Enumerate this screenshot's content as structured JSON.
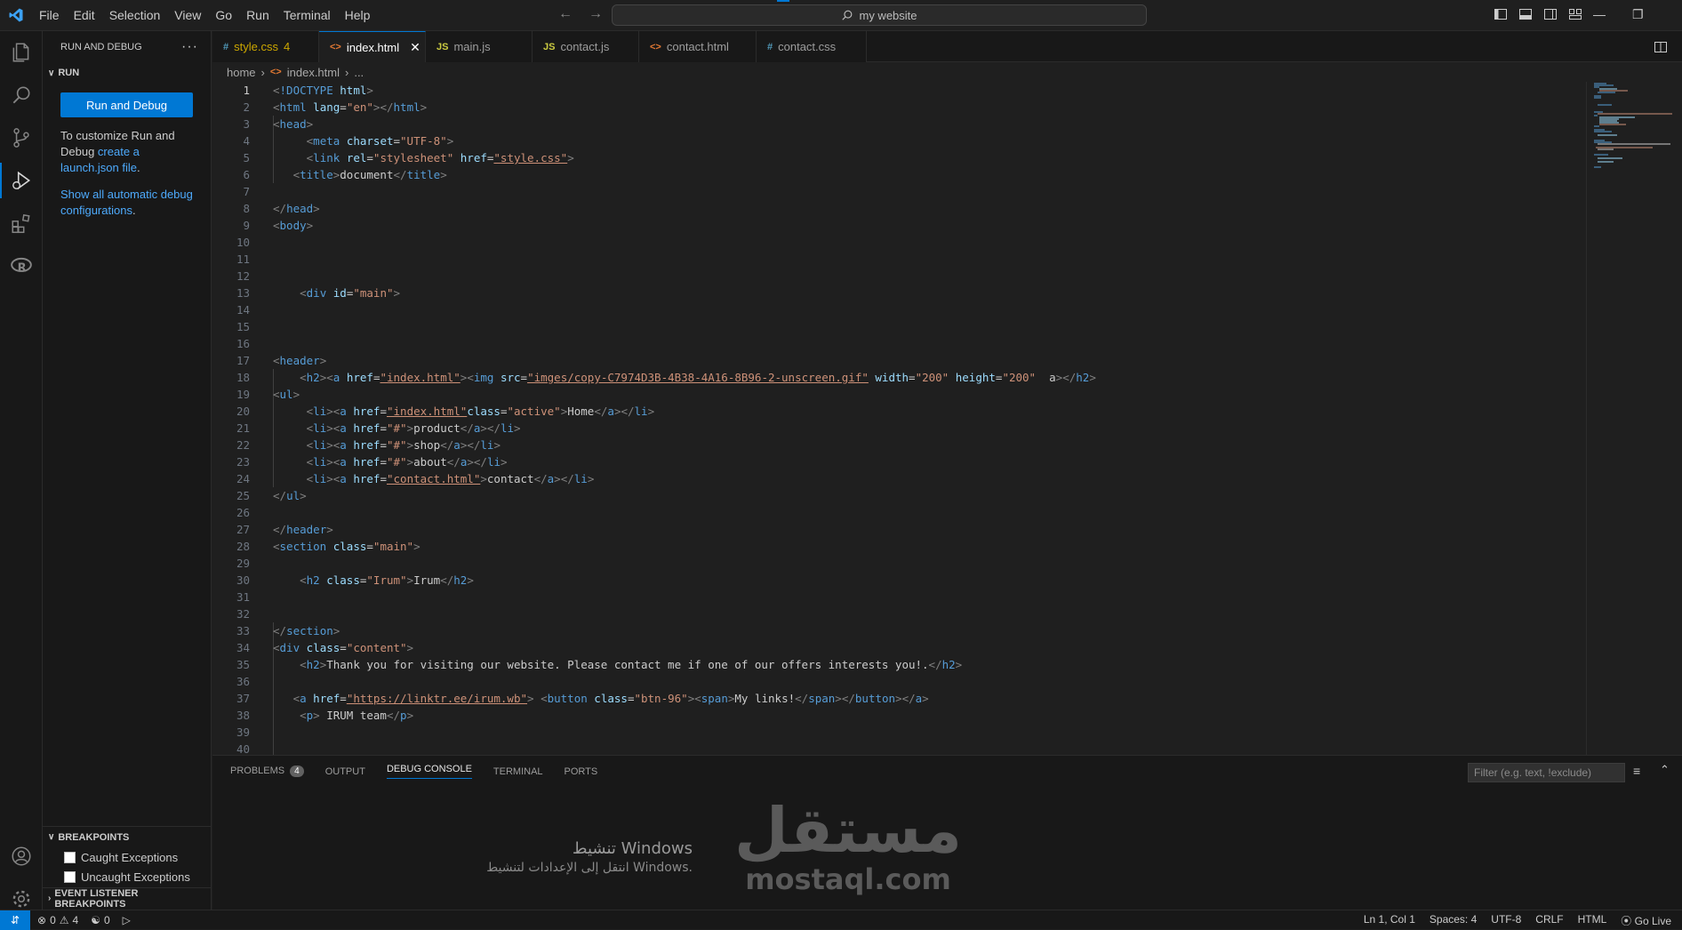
{
  "menu": [
    "File",
    "Edit",
    "Selection",
    "View",
    "Go",
    "Run",
    "Terminal",
    "Help"
  ],
  "search": {
    "text": "my website"
  },
  "sidebar": {
    "title": "RUN AND DEBUG",
    "section": "RUN",
    "run_button": "Run and Debug",
    "customize_prefix": "To customize Run and Debug ",
    "customize_link": "create a launch.json file",
    "customize_suffix": ".",
    "show_link": "Show all automatic debug configurations",
    "show_suffix": ".",
    "breakpoints_title": "BREAKPOINTS",
    "caught": "Caught Exceptions",
    "uncaught": "Uncaught Exceptions",
    "event_listener": "EVENT LISTENER BREAKPOINTS"
  },
  "tabs": [
    {
      "icon": "#",
      "label": "style.css",
      "badge": "4",
      "active": false
    },
    {
      "icon": "<>",
      "label": "index.html",
      "active": true
    },
    {
      "icon": "JS",
      "label": "main.js",
      "active": false
    },
    {
      "icon": "JS",
      "label": "contact.js",
      "active": false
    },
    {
      "icon": "<>",
      "label": "contact.html",
      "active": false
    },
    {
      "icon": "#",
      "label": "contact.css",
      "active": false
    }
  ],
  "breadcrumb": {
    "folder": "home",
    "file": "index.html",
    "more": "..."
  },
  "code_lines": [
    "<!DOCTYPE html>",
    "<html lang=\"en\"></html>",
    "<head>",
    "     <meta charset=\"UTF-8\">",
    "     <link rel=\"stylesheet\" href=\"style.css\">",
    "   <title>document</title>",
    "",
    "</head>",
    "<body>",
    "",
    "",
    "",
    "    <div id=\"main\">",
    "",
    "",
    "",
    "<header>",
    "    <h2><a href=\"index.html\"><img src=\"imges/copy-C7974D3B-4B38-4A16-8B96-2-unscreen.gif\" width=\"200\" height=\"200\"  </a></h2>",
    "<ul>",
    "     <li><a href=\"index.html\"class=\"active\">Home</a></li>",
    "     <li><a href=\"#\">product</a></li>",
    "     <li><a href=\"#\">shop</a></li>",
    "     <li><a href=\"#\">about</a></li>",
    "     <li><a href=\"contact.html\">contact</a></li>",
    "</ul>",
    "",
    "</header>",
    "<section class=\"main\">",
    "",
    "    <h2 class=\"Irum\">Irum</h2>",
    "",
    "",
    "</section>",
    "<div class=\"content\">",
    "    <h2>Thank you for visiting our website. Please contact me if one of our offers interests you!.</h2>",
    "",
    "   <a href=\"https://linktr.ee/irum.wb\"> <button class=\"btn-96\"><span>My links!</span></button></a>",
    "    <p> IRUM team</p>",
    "",
    ""
  ],
  "panel": {
    "tabs": [
      "PROBLEMS",
      "OUTPUT",
      "DEBUG CONSOLE",
      "TERMINAL",
      "PORTS"
    ],
    "problems_count": "4",
    "active_tab": "DEBUG CONSOLE",
    "filter_placeholder": "Filter (e.g. text, !exclude)"
  },
  "watermark": {
    "windows_line1": "تنشيط Windows",
    "windows_line2": "انتقل إلى الإعدادات لتنشيط Windows.",
    "brand_ar": "مستقل",
    "brand_en": "mostaql.com"
  },
  "status": {
    "errors": "0",
    "warnings": "4",
    "ports": "0",
    "position": "Ln 1, Col 1",
    "spaces": "Spaces: 4",
    "encoding": "UTF-8",
    "eol": "CRLF",
    "language": "HTML",
    "golive": "Go Live"
  },
  "colors": {
    "accent": "#0078d4",
    "tag": "#569cd6",
    "attr": "#9cdcfe",
    "value": "#ce9178"
  }
}
